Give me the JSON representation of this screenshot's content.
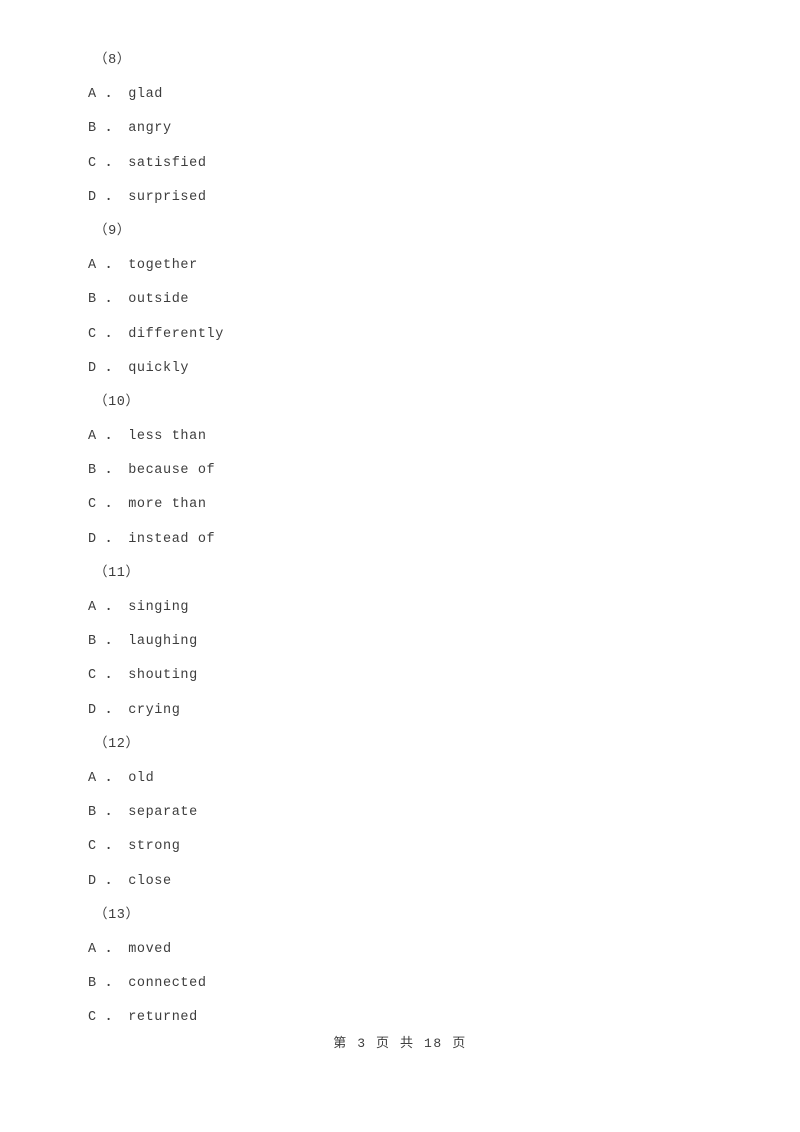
{
  "document": {
    "page_footer": "第 3 页 共 18 页"
  },
  "blocks": [
    {
      "number": "（8）",
      "options": [
        "A ． glad",
        "B ． angry",
        "C ． satisfied",
        "D ． surprised"
      ]
    },
    {
      "number": "（9）",
      "options": [
        "A ． together",
        "B ． outside",
        "C ． differently",
        "D ． quickly"
      ]
    },
    {
      "number": "（10）",
      "options": [
        "A ． less than",
        "B ． because of",
        "C ． more than",
        "D ． instead of"
      ]
    },
    {
      "number": "（11）",
      "options": [
        "A ． singing",
        "B ． laughing",
        "C ． shouting",
        "D ． crying"
      ]
    },
    {
      "number": "（12）",
      "options": [
        "A ． old",
        "B ． separate",
        "C ． strong",
        "D ． close"
      ]
    },
    {
      "number": "（13）",
      "options": [
        "A ． moved",
        "B ． connected",
        "C ． returned"
      ]
    }
  ]
}
